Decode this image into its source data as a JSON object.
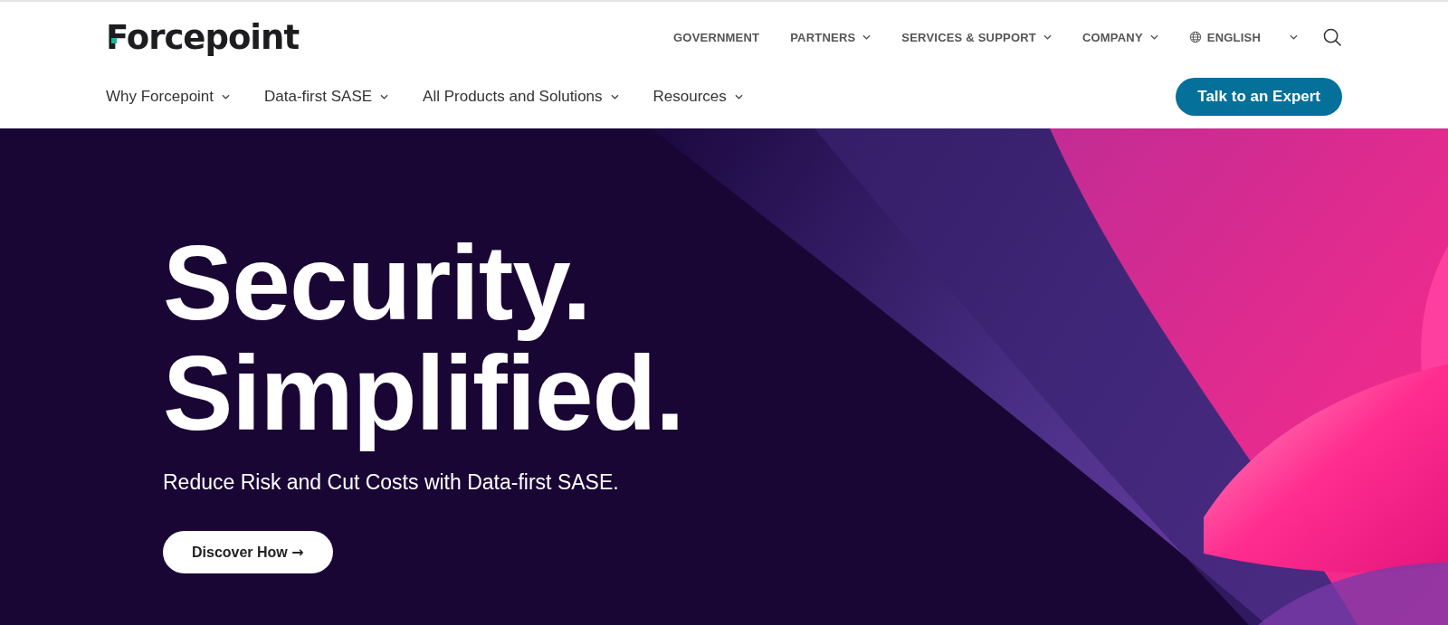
{
  "logo": {
    "text": "Forcepoint"
  },
  "utility_nav": [
    {
      "label": "GOVERNMENT",
      "dropdown": false
    },
    {
      "label": "PARTNERS",
      "dropdown": true
    },
    {
      "label": "SERVICES & SUPPORT",
      "dropdown": true
    },
    {
      "label": "COMPANY",
      "dropdown": true
    }
  ],
  "language": {
    "label": "ENGLISH"
  },
  "main_nav": [
    {
      "label": "Why Forcepoint",
      "dropdown": true
    },
    {
      "label": "Data-first SASE",
      "dropdown": true
    },
    {
      "label": "All Products and Solutions",
      "dropdown": true
    },
    {
      "label": "Resources",
      "dropdown": true
    }
  ],
  "cta_button": "Talk to an Expert",
  "hero": {
    "headline": [
      "Security.",
      "Simplified."
    ],
    "subtitle": "Reduce Risk and Cut Costs with Data-first SASE.",
    "button": "Discover How",
    "button_arrow": "→"
  }
}
